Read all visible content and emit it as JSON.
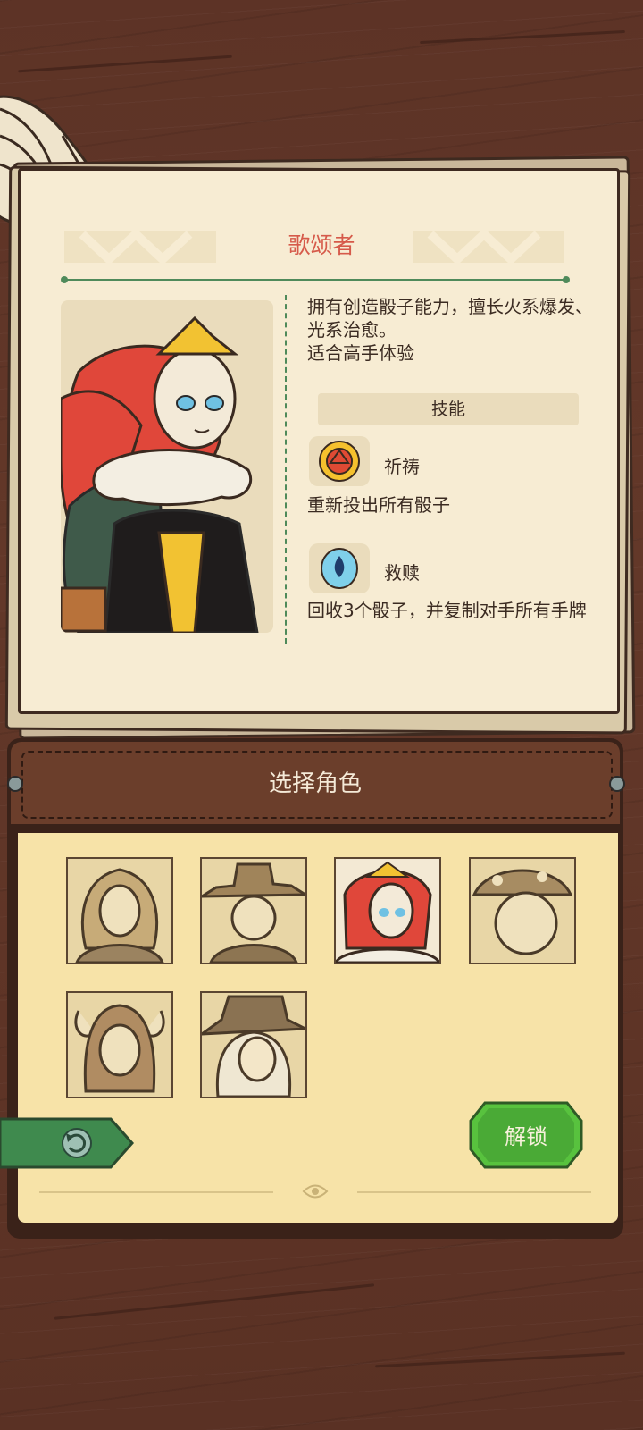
{
  "character": {
    "name": "歌颂者",
    "description": "拥有创造骰子能力，擅长火系爆发、光系治愈。",
    "recommendation": "适合高手体验"
  },
  "skills": {
    "header": "技能",
    "items": [
      {
        "name": "祈祷",
        "description": "重新投出所有骰子",
        "icon": "sun-dice-icon"
      },
      {
        "name": "救赎",
        "description": "回收3个骰子，并复制对手所有手牌",
        "icon": "blue-skull-icon"
      }
    ]
  },
  "selector": {
    "title": "选择角色",
    "characters": [
      {
        "id": "curly-hair-character",
        "selected": false
      },
      {
        "id": "cowboy-hat-character",
        "selected": false
      },
      {
        "id": "singer-character",
        "selected": true
      },
      {
        "id": "mushroom-character",
        "selected": false
      },
      {
        "id": "horned-character",
        "selected": false
      },
      {
        "id": "witch-hat-character",
        "selected": false
      }
    ]
  },
  "buttons": {
    "unlock": "解锁",
    "back_icon": "undo-arrow-icon"
  },
  "colors": {
    "title_red": "#d65a4a",
    "accent_green": "#4f8a5a",
    "button_green": "#4caf3e",
    "paper": "#f7ecd3",
    "panel_body": "#f7e3a8",
    "leather": "#6b3e2b"
  }
}
